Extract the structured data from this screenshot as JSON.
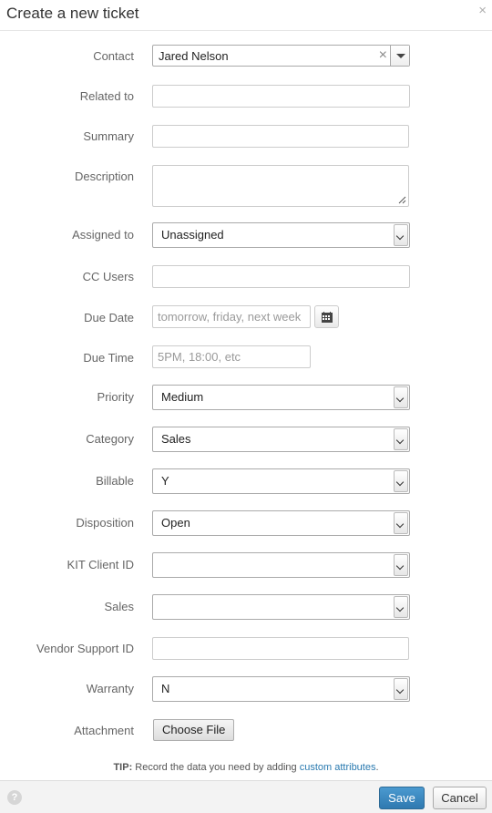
{
  "header": {
    "title": "Create a new ticket",
    "close_glyph": "×"
  },
  "fields": {
    "contact": {
      "label": "Contact",
      "value": "Jared Nelson",
      "clear_glyph": "×"
    },
    "related_to": {
      "label": "Related to",
      "value": ""
    },
    "summary": {
      "label": "Summary",
      "value": ""
    },
    "description": {
      "label": "Description",
      "value": ""
    },
    "assigned_to": {
      "label": "Assigned to",
      "value": "Unassigned"
    },
    "cc_users": {
      "label": "CC Users",
      "value": ""
    },
    "due_date": {
      "label": "Due Date",
      "value": "",
      "placeholder": "tomorrow, friday, next week"
    },
    "due_time": {
      "label": "Due Time",
      "value": "",
      "placeholder": "5PM, 18:00, etc"
    },
    "priority": {
      "label": "Priority",
      "value": "Medium"
    },
    "category": {
      "label": "Category",
      "value": "Sales"
    },
    "billable": {
      "label": "Billable",
      "value": "Y"
    },
    "disposition": {
      "label": "Disposition",
      "value": "Open"
    },
    "kit_client_id": {
      "label": "KIT Client ID",
      "value": ""
    },
    "sales": {
      "label": "Sales",
      "value": ""
    },
    "vendor_support_id": {
      "label": "Vendor Support ID",
      "value": ""
    },
    "warranty": {
      "label": "Warranty",
      "value": "N"
    },
    "attachment": {
      "label": "Attachment",
      "button_label": "Choose File"
    }
  },
  "tip": {
    "prefix": "TIP:",
    "text": "Record the data you need by adding",
    "link": "custom attributes",
    "suffix": "."
  },
  "footer": {
    "help_glyph": "?",
    "save_label": "Save",
    "cancel_label": "Cancel"
  },
  "colors": {
    "primary": "#2f79b0",
    "link": "#2a7ab0",
    "label": "#666666"
  },
  "icons": [
    "close-icon",
    "clear-icon",
    "chevron-down-icon",
    "calendar-icon",
    "resize-grip-icon",
    "help-icon"
  ]
}
